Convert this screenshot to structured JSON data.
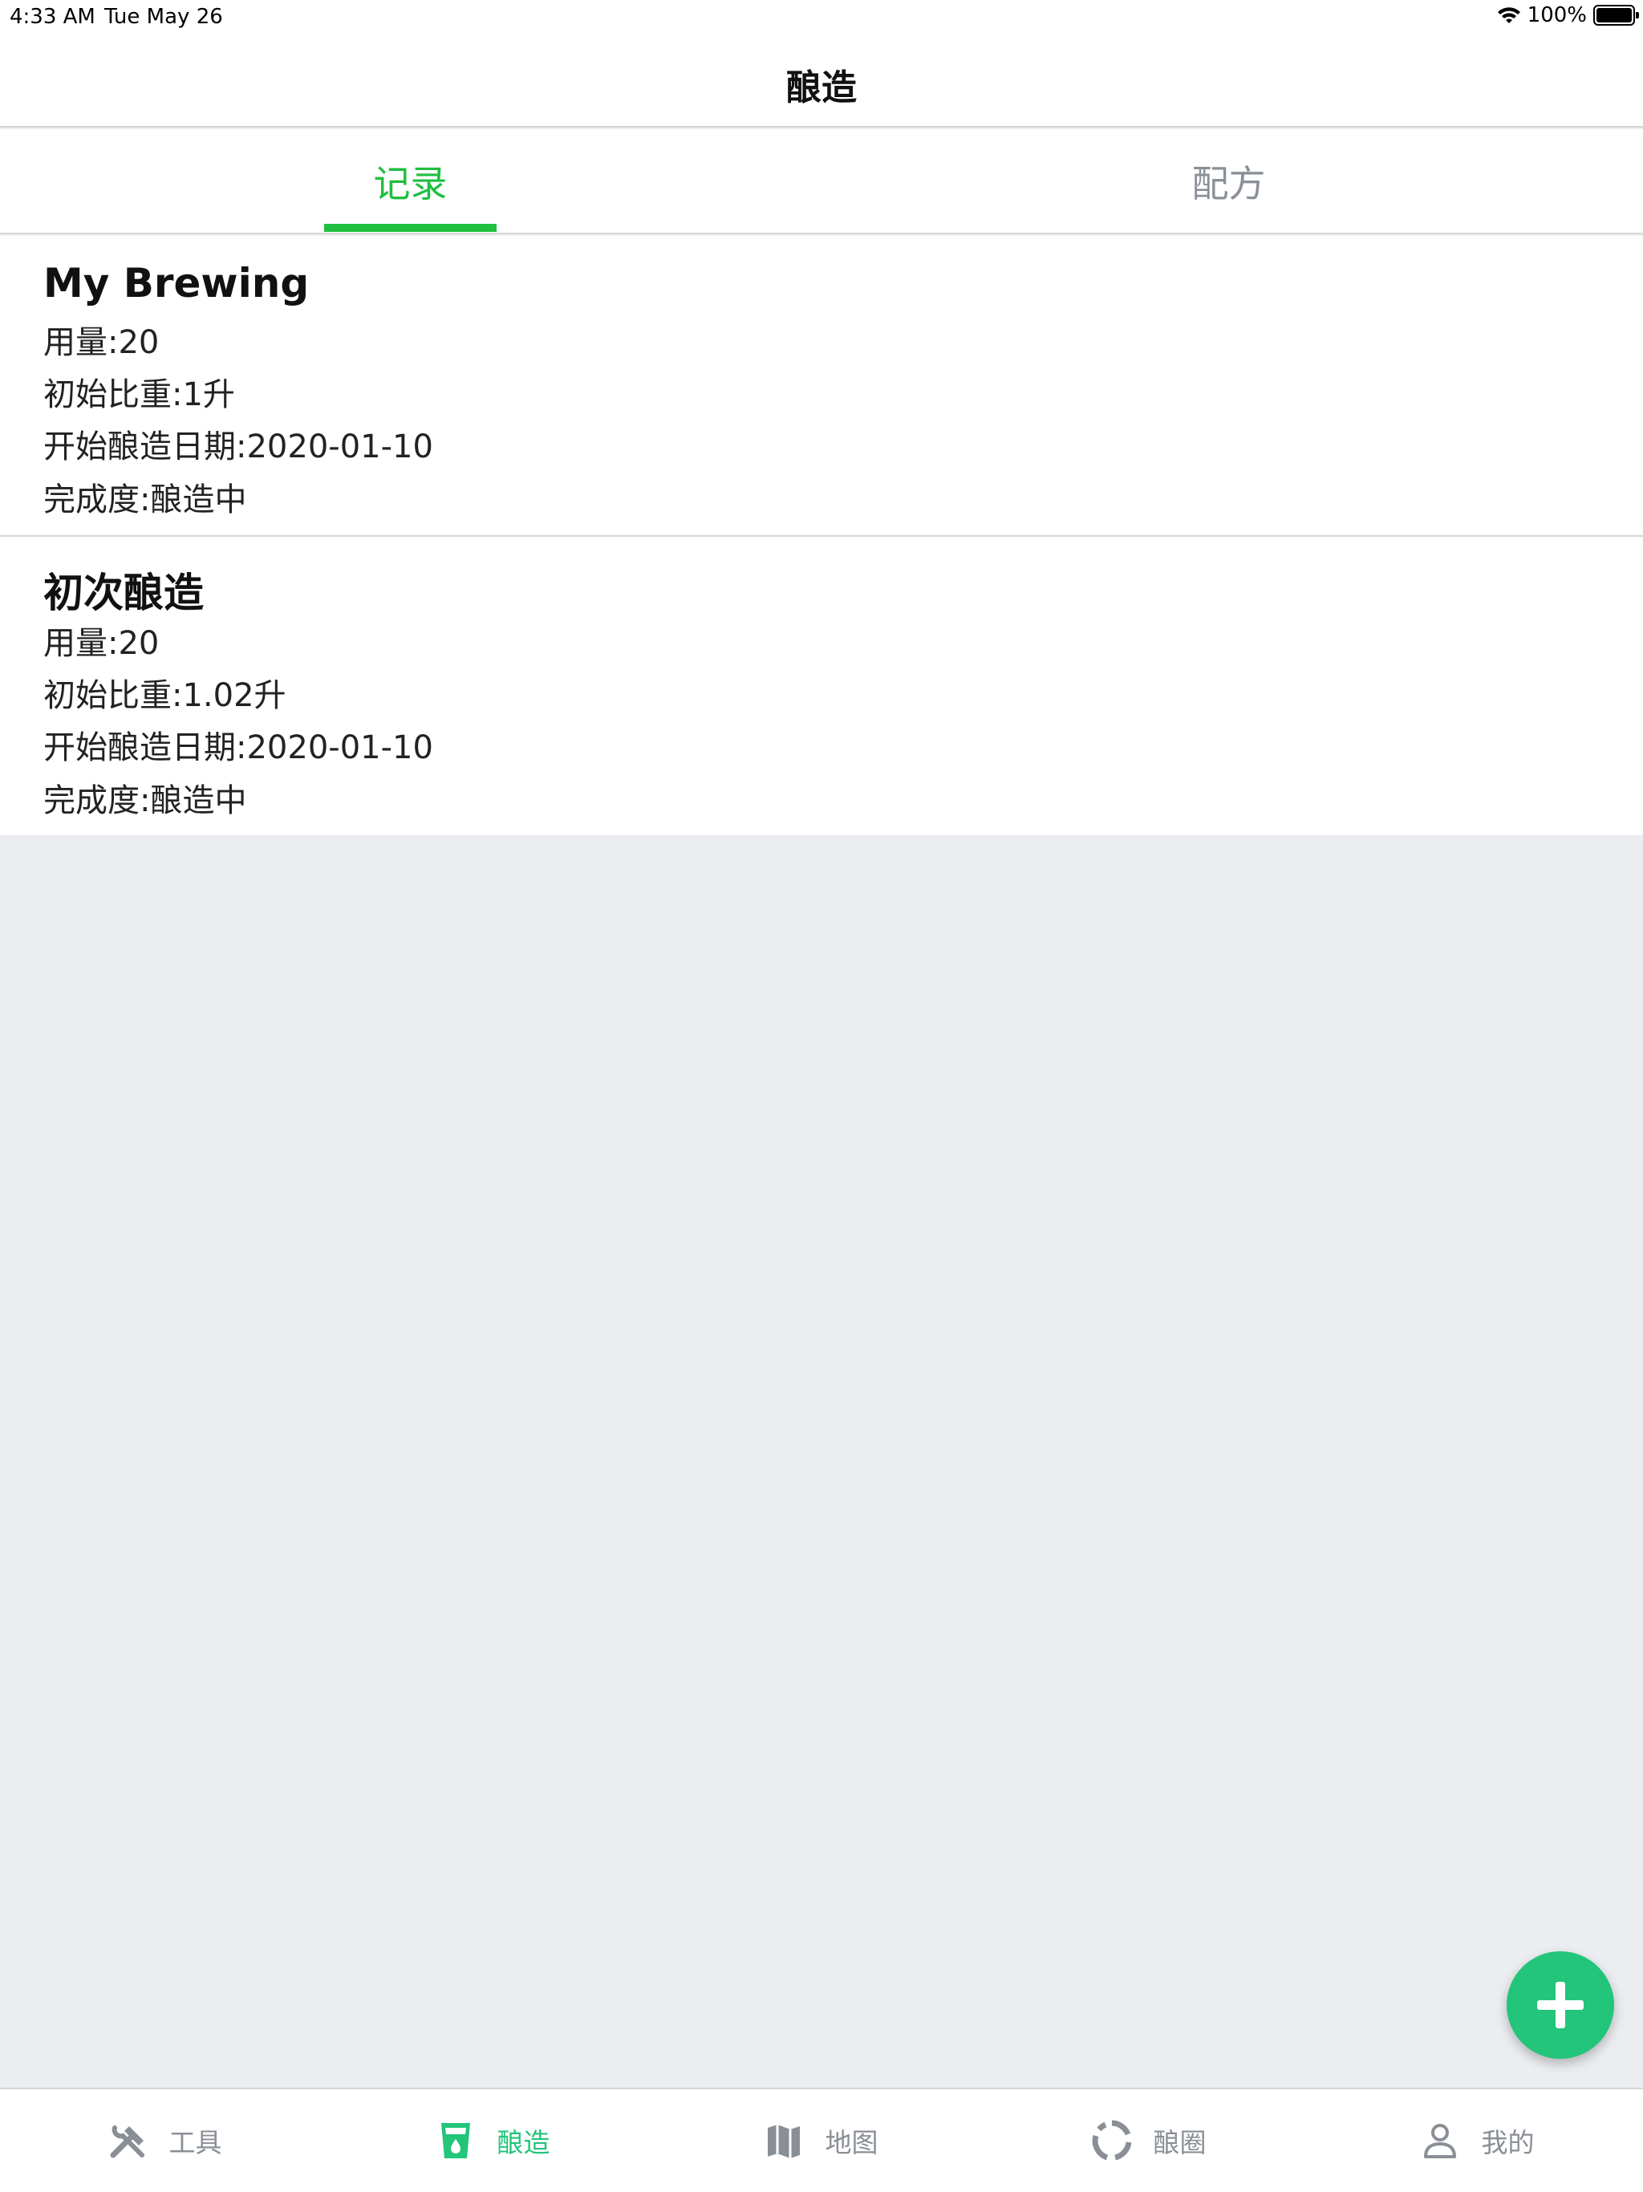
{
  "status": {
    "time": "4:33 AM",
    "date": "Tue May 26",
    "battery": "100%"
  },
  "nav": {
    "title": "酿造"
  },
  "tabs": {
    "records": "记录",
    "recipes": "配方"
  },
  "records": [
    {
      "name": "My Brewing",
      "amount": "用量:20",
      "gravity": "初始比重:1升",
      "start_date": "开始酿造日期:2020-01-10",
      "progress": "完成度:酿造中"
    },
    {
      "name": "初次酿造",
      "amount": "用量:20",
      "gravity": "初始比重:1.02升",
      "start_date": "开始酿造日期:2020-01-10",
      "progress": "完成度:酿造中"
    }
  ],
  "tabbar": {
    "items": [
      {
        "label": "工具",
        "icon": "tools-icon"
      },
      {
        "label": "酿造",
        "icon": "brew-cup-icon"
      },
      {
        "label": "地图",
        "icon": "map-icon"
      },
      {
        "label": "酿圈",
        "icon": "circle-icon"
      },
      {
        "label": "我的",
        "icon": "person-icon"
      }
    ]
  },
  "colors": {
    "accent": "#1fbf3f",
    "fab": "#22c57a",
    "inactive": "#8a8f96",
    "background": "#ebedf0"
  }
}
